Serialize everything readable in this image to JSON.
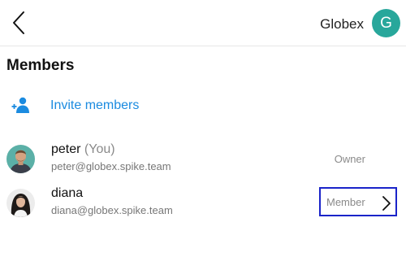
{
  "header": {
    "org_name": "Globex",
    "org_initial": "G",
    "avatar_color": "#28a79b"
  },
  "section_title": "Members",
  "invite": {
    "label": "Invite members",
    "color": "#1b8be0"
  },
  "members": [
    {
      "name": "peter",
      "tag": "(You)",
      "email": "peter@globex.spike.team",
      "role": "Owner"
    },
    {
      "name": "diana",
      "tag": "",
      "email": "diana@globex.spike.team",
      "role": "Member"
    }
  ]
}
